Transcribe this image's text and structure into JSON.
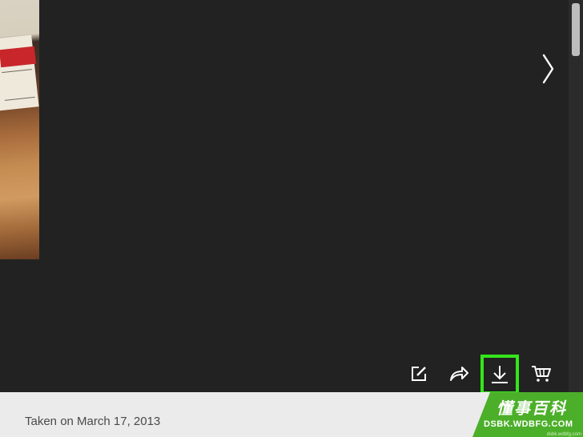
{
  "viewer": {
    "background": "#222222",
    "next_icon": "chevron-right-icon"
  },
  "toolbar": {
    "edit_icon": "edit-icon",
    "share_icon": "share-arrow-icon",
    "download_icon": "download-icon",
    "cart_icon": "shopping-cart-icon",
    "highlight_color": "#35e51c"
  },
  "info": {
    "taken_text": "Taken on March 17, 2013"
  },
  "watermark": {
    "title": "懂事百科",
    "subtitle": "DSBK.WDBFG.COM",
    "tiny": "dsbk.wdbfg.com",
    "color": "#4caf2a"
  }
}
